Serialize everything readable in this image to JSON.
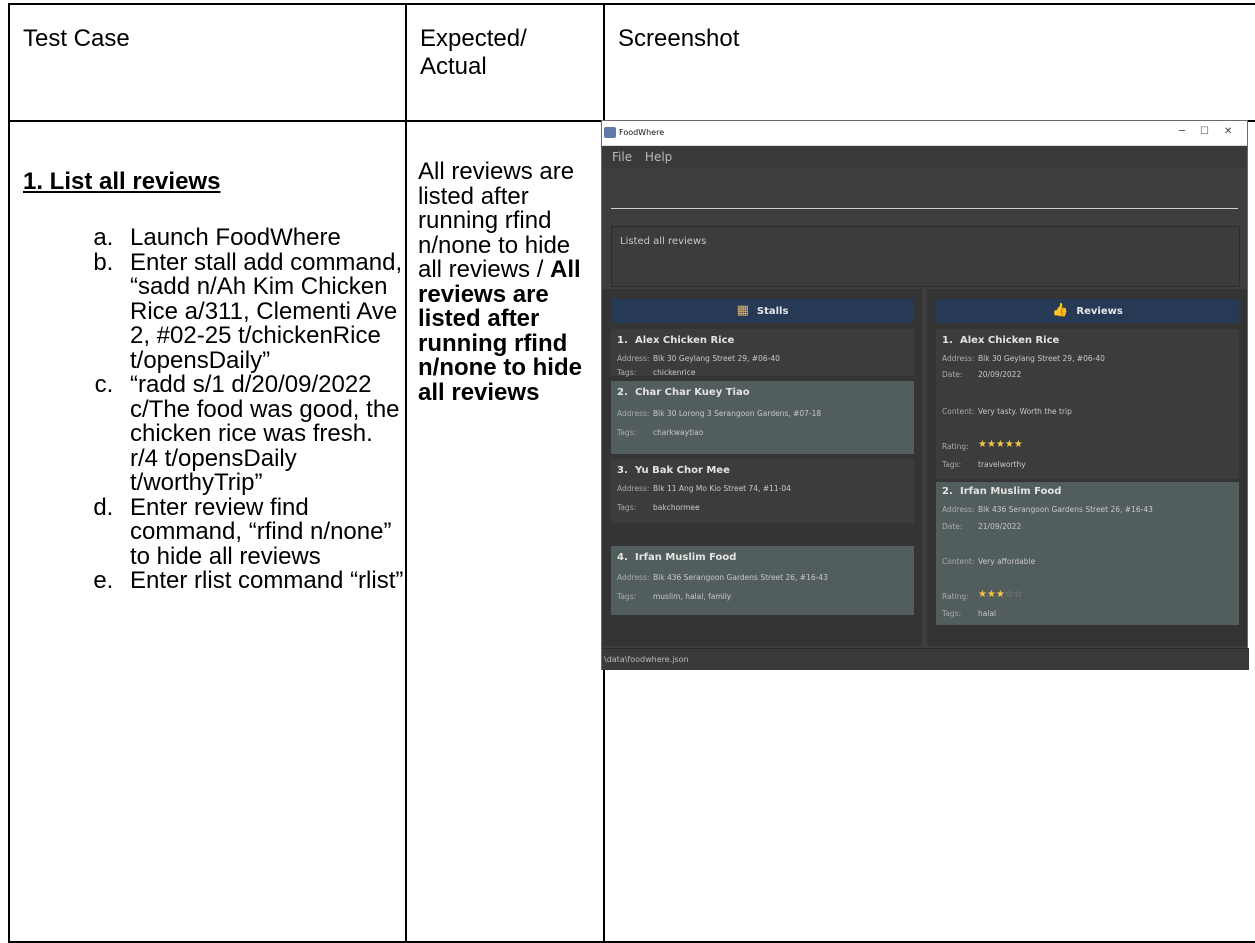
{
  "table": {
    "headers": [
      "Test Case",
      "Expected/\nActual",
      "Screenshot"
    ],
    "test_case": {
      "title": "1. List all reviews",
      "steps": [
        "Launch FoodWhere",
        "Enter stall add command, “sadd n/Ah Kim Chicken Rice a/311, Clementi Ave 2, #02-25 t/chickenRice t/opensDaily”",
        "“radd s/1 d/20/09/2022 c/The food was good, the chicken rice was fresh. r/4 t/opensDaily t/worthyTrip”",
        "Enter review find command, “rfind n/none” to hide all reviews",
        "Enter rlist command “rlist”"
      ]
    },
    "expected": "All reviews are listed after running rfind n/none to hide all reviews / ",
    "actual": "All reviews are listed after running rfind n/none to hide all reviews"
  },
  "app": {
    "title": "FoodWhere",
    "menu": [
      "File",
      "Help"
    ],
    "result": "Listed all reviews",
    "status": "\\data\\foodwhere.json",
    "stalls_title": "Stalls",
    "reviews_title": "Reviews",
    "labels": {
      "address": "Address:",
      "tags": "Tags:",
      "date": "Date:",
      "content": "Content:",
      "rating": "Rating:"
    },
    "stalls": [
      {
        "num": "1.",
        "name": "Alex Chicken Rice",
        "address": "Blk 30 Geylang Street 29, #06-40",
        "tags": "chickenrice"
      },
      {
        "num": "2.",
        "name": "Char Char Kuey Tiao",
        "address": "Blk 30 Lorong 3 Serangoon Gardens, #07-18",
        "tags": "charkwaytiao"
      },
      {
        "num": "3.",
        "name": "Yu Bak Chor Mee",
        "address": "Blk 11 Ang Mo Kio Street 74, #11-04",
        "tags": "bakchormee"
      },
      {
        "num": "4.",
        "name": "Irfan Muslim Food",
        "address": "Blk 436 Serangoon Gardens Street 26, #16-43",
        "tags": "muslim, halal, family"
      }
    ],
    "reviews": [
      {
        "num": "1.",
        "name": "Alex Chicken Rice",
        "address": "Blk 30 Geylang Street 29, #06-40",
        "date": "20/09/2022",
        "content": "Very tasty. Worth the trip",
        "rating": 5,
        "tags": "travelworthy"
      },
      {
        "num": "2.",
        "name": "Irfan Muslim Food",
        "address": "Blk 436 Serangoon Gardens Street 26, #16-43",
        "date": "21/09/2022",
        "content": "Very affordable",
        "rating": 3,
        "tags": "halal"
      }
    ],
    "colors": {
      "accent_header": "#263a55",
      "star": "#f2c648"
    }
  }
}
